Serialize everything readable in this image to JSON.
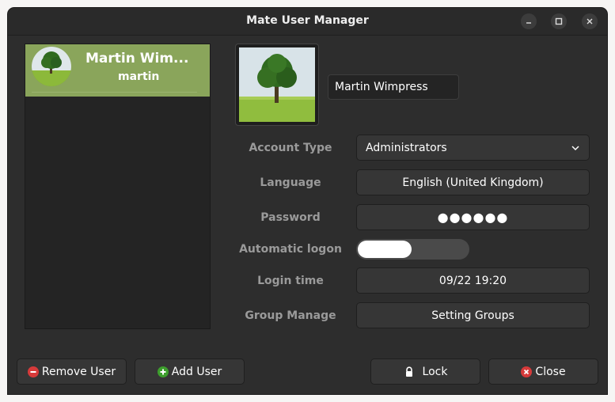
{
  "window": {
    "title": "Mate User Manager"
  },
  "users": [
    {
      "display_name": "Martin Wim...",
      "login": "martin"
    }
  ],
  "details": {
    "full_name": "Martin Wimpress",
    "fields": {
      "account_type": {
        "label": "Account Type",
        "value": "Administrators"
      },
      "language": {
        "label": "Language",
        "value": "English (United Kingdom)"
      },
      "password": {
        "label": "Password",
        "value": "●●●●●●"
      },
      "automatic_logon": {
        "label": "Automatic logon",
        "enabled": false
      },
      "login_time": {
        "label": "Login time",
        "value": "09/22 19:20"
      },
      "group_manage": {
        "label": "Group Manage",
        "value": "Setting Groups"
      }
    }
  },
  "buttons": {
    "remove_user": "Remove User",
    "add_user": "Add User",
    "lock": "Lock",
    "close": "Close"
  },
  "colors": {
    "selected_row": "#8aa55b",
    "remove_icon": "#d63a3a",
    "add_icon": "#3d9e2d",
    "close_icon": "#d63a3a"
  },
  "icons": {
    "minimize": "minimize-icon",
    "maximize": "maximize-icon",
    "window_close": "close-icon",
    "account_type_dropdown": "chevron-down-icon",
    "remove_user": "minus-circle-icon",
    "add_user": "plus-circle-icon",
    "lock": "lock-icon",
    "close": "close-circle-icon"
  }
}
